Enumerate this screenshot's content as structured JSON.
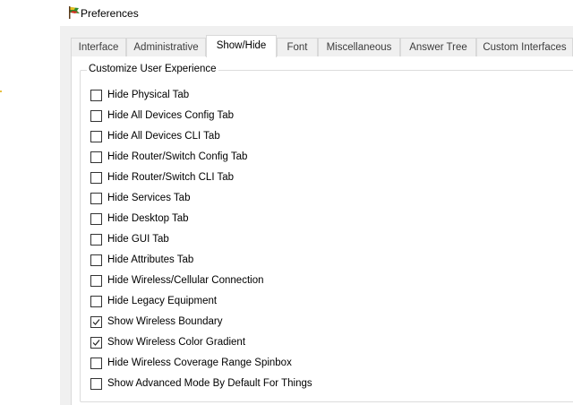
{
  "window": {
    "title": "Preferences",
    "icon": "packet-tracer-app-icon"
  },
  "tabs": [
    {
      "label": "Interface",
      "active": false
    },
    {
      "label": "Administrative",
      "active": false
    },
    {
      "label": "Show/Hide",
      "active": true
    },
    {
      "label": "Font",
      "active": false
    },
    {
      "label": "Miscellaneous",
      "active": false
    },
    {
      "label": "Answer Tree",
      "active": false
    },
    {
      "label": "Custom Interfaces",
      "active": false
    }
  ],
  "group": {
    "title": "Customize User Experience",
    "options": [
      {
        "label": "Hide Physical Tab",
        "checked": false
      },
      {
        "label": "Hide All Devices Config Tab",
        "checked": false
      },
      {
        "label": "Hide All Devices CLI Tab",
        "checked": false
      },
      {
        "label": "Hide Router/Switch Config Tab",
        "checked": false
      },
      {
        "label": "Hide Router/Switch CLI Tab",
        "checked": false
      },
      {
        "label": "Hide Services Tab",
        "checked": false
      },
      {
        "label": "Hide Desktop Tab",
        "checked": false
      },
      {
        "label": "Hide GUI Tab",
        "checked": false
      },
      {
        "label": "Hide Attributes Tab",
        "checked": false
      },
      {
        "label": "Hide Wireless/Cellular Connection",
        "checked": false
      },
      {
        "label": "Hide Legacy Equipment",
        "checked": false
      },
      {
        "label": "Show Wireless Boundary",
        "checked": true
      },
      {
        "label": "Show Wireless Color Gradient",
        "checked": true
      },
      {
        "label": "Hide Wireless Coverage Range Spinbox",
        "checked": false
      },
      {
        "label": "Show Advanced Mode By Default For Things",
        "checked": false
      }
    ]
  }
}
